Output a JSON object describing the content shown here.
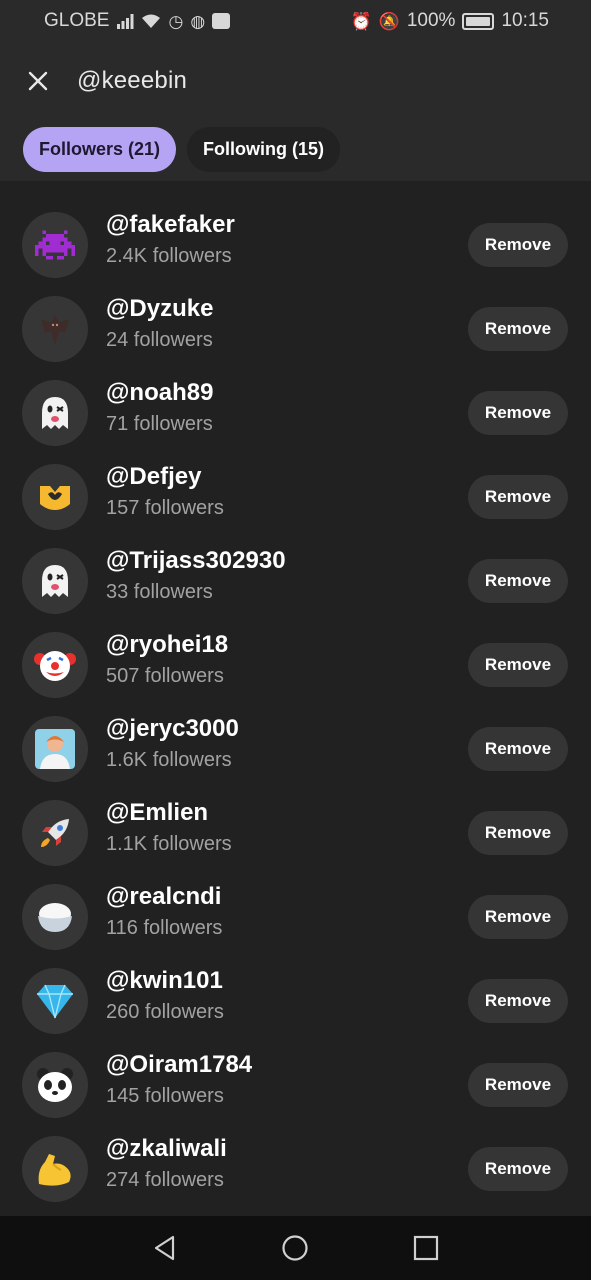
{
  "status_bar": {
    "carrier": "GLOBE",
    "battery": "100%",
    "time": "10:15",
    "icons_left": [
      "signal-icon",
      "wifi-icon",
      "clock-icon",
      "messenger-icon",
      "app-icon"
    ],
    "icons_right": [
      "alarm-icon",
      "mute-icon",
      "battery-icon"
    ]
  },
  "header": {
    "title": "@keeebin",
    "close_icon": "close-icon"
  },
  "tabs": [
    {
      "label": "Followers (21)",
      "active": true
    },
    {
      "label": "Following (15)",
      "active": false
    }
  ],
  "colors": {
    "accent": "#b5a4f3",
    "background": "#212121",
    "button": "#353535",
    "muted_text": "#a2a2a2"
  },
  "remove_label": "Remove",
  "followers": [
    {
      "handle": "@fakefaker",
      "followers": "2.4K followers",
      "avatar": "space-invader-icon"
    },
    {
      "handle": "@Dyzuke",
      "followers": "24 followers",
      "avatar": "bat-icon"
    },
    {
      "handle": "@noah89",
      "followers": "71 followers",
      "avatar": "ghost-icon"
    },
    {
      "handle": "@Defjey",
      "followers": "157 followers",
      "avatar": "heart-hands-icon"
    },
    {
      "handle": "@Trijass302930",
      "followers": "33 followers",
      "avatar": "ghost-icon"
    },
    {
      "handle": "@ryohei18",
      "followers": "507 followers",
      "avatar": "clown-icon"
    },
    {
      "handle": "@jeryc3000",
      "followers": "1.6K followers",
      "avatar": "person-in-steam-icon"
    },
    {
      "handle": "@Emlien",
      "followers": "1.1K followers",
      "avatar": "rocket-icon"
    },
    {
      "handle": "@realcndi",
      "followers": "116 followers",
      "avatar": "rice-bowl-icon"
    },
    {
      "handle": "@kwin101",
      "followers": "260 followers",
      "avatar": "gem-icon"
    },
    {
      "handle": "@Oiram1784",
      "followers": "145 followers",
      "avatar": "panda-icon"
    },
    {
      "handle": "@zkaliwali",
      "followers": "274 followers",
      "avatar": "flexed-biceps-icon"
    }
  ],
  "navbar": {
    "back": "back-icon",
    "home": "home-icon",
    "recents": "recents-icon"
  }
}
